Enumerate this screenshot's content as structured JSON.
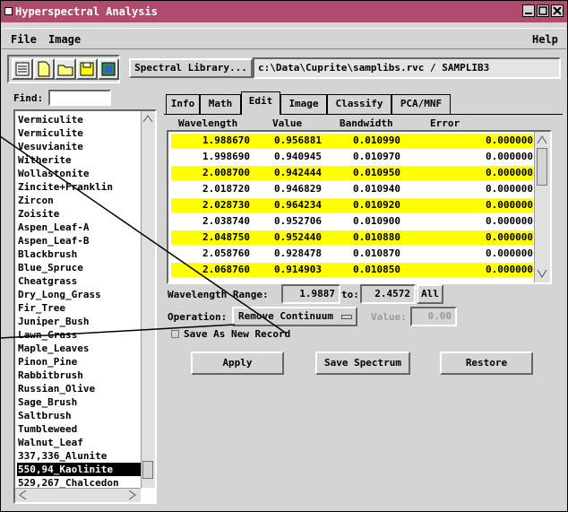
{
  "window": {
    "title": "Hyperspectral Analysis"
  },
  "menu": {
    "file": "File",
    "image": "Image",
    "help": "Help"
  },
  "toolbar": {
    "icons": [
      "open-file-icon",
      "new-file-icon",
      "open-folder-icon",
      "save-icon",
      "image-icon"
    ],
    "spectral_library_button": "Spectral Library...",
    "library_path": "c:\\Data\\Cuprite\\samplibs.rvc / SAMPLIB3"
  },
  "find": {
    "label": "Find:",
    "value": ""
  },
  "library_list": [
    "Vermiculite",
    "Vermiculite",
    "Vesuvianite",
    "Witherite",
    "Wollastonite",
    "Zincite+Franklin",
    "Zircon",
    "Zoisite",
    "Aspen_Leaf-A",
    "Aspen_Leaf-B",
    "Blackbrush",
    "Blue_Spruce",
    "Cheatgrass",
    "Dry_Long_Grass",
    "Fir_Tree",
    "Juniper_Bush",
    "Lawn_Grass",
    "Maple_Leaves",
    "Pinon_Pine",
    "Rabbitbrush",
    "Russian_Olive",
    "Sage_Brush",
    "Saltbrush",
    "Tumbleweed",
    "Walnut_Leaf",
    "337,336_Alunite",
    "550,94_Kaolinite",
    "529,267_Chalcedon"
  ],
  "selected_index": 26,
  "tabs": [
    "Info",
    "Math",
    "Edit",
    "Image",
    "Classify",
    "PCA/MNF"
  ],
  "active_tab": "Edit",
  "table": {
    "headers": [
      "Wavelength",
      "Value",
      "Bandwidth",
      "Error"
    ],
    "rows": [
      [
        "1.988670",
        "0.956881",
        "0.010990",
        "0.000000"
      ],
      [
        "1.998690",
        "0.940945",
        "0.010970",
        "0.000000"
      ],
      [
        "2.008700",
        "0.942444",
        "0.010950",
        "0.000000"
      ],
      [
        "2.018720",
        "0.946829",
        "0.010940",
        "0.000000"
      ],
      [
        "2.028730",
        "0.964234",
        "0.010920",
        "0.000000"
      ],
      [
        "2.038740",
        "0.952706",
        "0.010900",
        "0.000000"
      ],
      [
        "2.048750",
        "0.952440",
        "0.010880",
        "0.000000"
      ],
      [
        "2.058760",
        "0.928478",
        "0.010870",
        "0.000000"
      ],
      [
        "2.068760",
        "0.914903",
        "0.010850",
        "0.000000"
      ]
    ],
    "highlight_color": "#ffff00"
  },
  "range": {
    "label": "Wavelength Range:",
    "from": "1.9887",
    "to_label": "to:",
    "to": "2.4572",
    "all_button": "All"
  },
  "operation": {
    "label": "Operation:",
    "value": "Remove Continuum",
    "value_label": "Value:",
    "value_field": "0.00"
  },
  "save_new_record": "Save As New Record",
  "buttons": {
    "apply": "Apply",
    "save_spectrum": "Save Spectrum",
    "restore": "Restore"
  },
  "colors": {
    "titlebar": "#b04a6e",
    "panel": "#d4d4d4"
  }
}
